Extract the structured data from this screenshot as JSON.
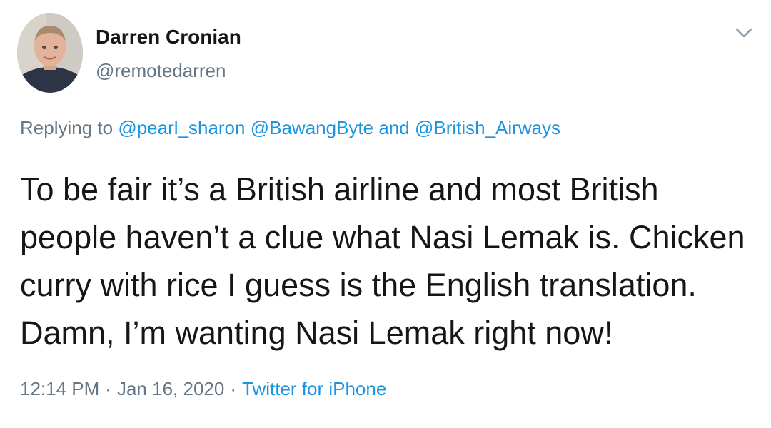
{
  "author": {
    "display_name": "Darren Cronian",
    "handle": "@remotedarren"
  },
  "reply_context": {
    "prefix": "Replying to",
    "mention_1": "@pearl_sharon",
    "mention_2": "@BawangByte",
    "conjunction": "and",
    "mention_3": "@British_Airways"
  },
  "tweet": {
    "text": "To be fair it’s a British airline and most British people haven’t a clue what Nasi Lemak is. Chicken curry with rice I guess is the English translation. Damn, I’m wanting Nasi Lemak right now!",
    "time": "12:14 PM",
    "separator": "·",
    "date": "Jan 16, 2020",
    "source": "Twitter for iPhone"
  },
  "icons": {
    "menu": "chevron-down-icon"
  },
  "colors": {
    "link": "#1b95e0",
    "secondary_text": "#657786",
    "primary_text": "#14171a"
  }
}
